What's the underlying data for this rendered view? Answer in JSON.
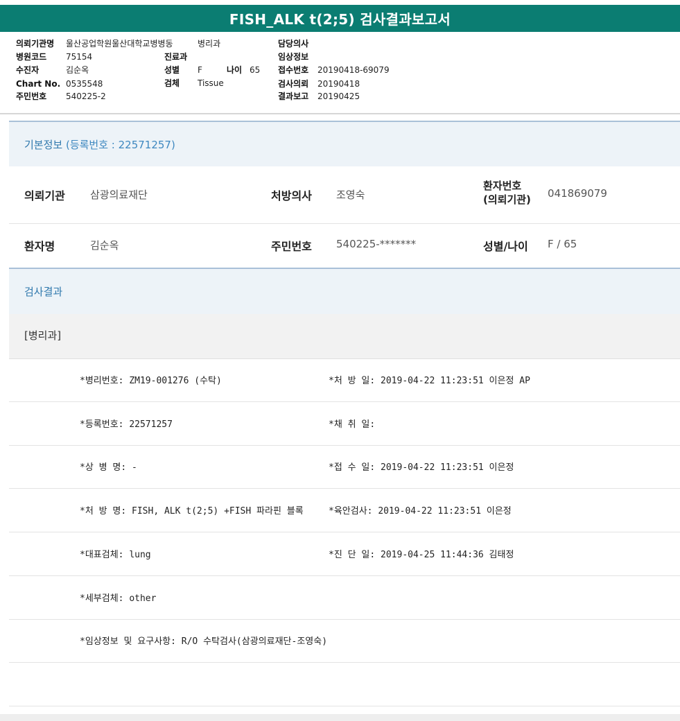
{
  "title": "FISH_ALK t(2;5) 검사결과보고서",
  "header": {
    "col1": [
      {
        "label": "의뢰기관명",
        "value": "울산공업학원울산대학교병병동"
      },
      {
        "label": "병원코드",
        "value": "75154"
      },
      {
        "label": "수진자",
        "value": "김순옥"
      },
      {
        "label": "Chart No.",
        "value": "0535548"
      },
      {
        "label": "주민번호",
        "value": "540225-2"
      }
    ],
    "ward_value": "병리과",
    "col2": [
      {
        "label": "진료과",
        "value": ""
      },
      {
        "label": "성별",
        "value": "F"
      },
      {
        "label": "검체",
        "value": "Tissue"
      }
    ],
    "age": {
      "label": "나이",
      "value": "65"
    },
    "col3": [
      {
        "label": "담당의사",
        "value": ""
      },
      {
        "label": "임상정보",
        "value": ""
      },
      {
        "label": "접수번호",
        "value": "20190418-69079"
      },
      {
        "label": "검사의뢰",
        "value": "20190418"
      },
      {
        "label": "결과보고",
        "value": "20190425"
      }
    ]
  },
  "basic_info": {
    "section_title": "기본정보",
    "reg_text": "(등록번호 : 22571257)",
    "row1": {
      "institution_label": "의뢰기관",
      "institution_value": "삼광의료재단",
      "doctor_label": "처방의사",
      "doctor_value": "조영숙",
      "patient_no_label_1": "환자번호",
      "patient_no_label_2": "(의뢰기관)",
      "patient_no_value": "041869079"
    },
    "row2": {
      "name_label": "환자명",
      "name_value": "김순옥",
      "rrn_label": "주민번호",
      "rrn_value": "540225-*******",
      "sex_age_label": "성별/나이",
      "sex_age_value": "F / 65"
    }
  },
  "results": {
    "section_title": "검사결과",
    "department": "[병리과]",
    "rows": [
      {
        "left": "*병리번호: ZM19-001276 (수탁)",
        "right": "*처 방 일: 2019-04-22 11:23:51  이은정 AP"
      },
      {
        "left": "*등록번호: 22571257",
        "right": "*채 취 일:"
      },
      {
        "left": "*상 병 명: -",
        "right": "*접 수 일: 2019-04-22 11:23:51  이은정"
      },
      {
        "left": "*처 방 명: FISH, ALK t(2;5) +FISH 파라핀 블록",
        "right": "*육안검사: 2019-04-22 11:23:51  이은정"
      },
      {
        "left": "*대표검체: lung",
        "right": "*진 단 일: 2019-04-25 11:44:36  김태정"
      },
      {
        "left": "*세부검체: other",
        "right": ""
      },
      {
        "left": "*임상정보 및 요구사항: R/O 수탁검사(삼광의료재단-조영숙)",
        "right": ""
      },
      {
        "left": "",
        "right": ""
      }
    ]
  },
  "colors": {
    "title_bar": "#0b7d72",
    "section_bg": "#edf3f8",
    "section_title": "#2f78ad"
  }
}
